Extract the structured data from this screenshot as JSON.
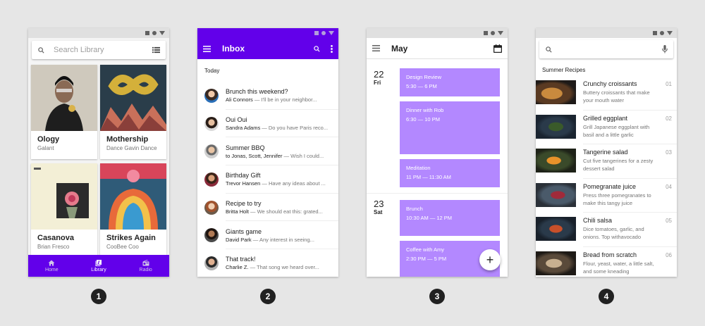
{
  "library": {
    "search_placeholder": "Search Library",
    "cards": [
      {
        "title": "Ology",
        "artist": "Galant"
      },
      {
        "title": "Mothership",
        "artist": "Dance Gavin Dance"
      },
      {
        "title": "Casanova",
        "artist": "Brian Fresco"
      },
      {
        "title": "Strikes Again",
        "artist": "CooBee Coo"
      }
    ],
    "nav": [
      {
        "label": "Home",
        "icon": "home-icon"
      },
      {
        "label": "Library",
        "icon": "library-icon"
      },
      {
        "label": "Radio",
        "icon": "radio-icon"
      }
    ],
    "accent": "#6200ea"
  },
  "inbox": {
    "title": "Inbox",
    "section": "Today",
    "emails": [
      {
        "subject": "Brunch this weekend?",
        "sender": "Ali Connors",
        "preview": " — I'll be in your neighbor..."
      },
      {
        "subject": "Oui Oui",
        "sender": "Sandra Adams",
        "preview": " — Do you have Paris reco..."
      },
      {
        "subject": "Summer BBQ",
        "sender": "to Jonas, Scott, Jennifer",
        "preview": " — Wish I could..."
      },
      {
        "subject": "Birthday Gift",
        "sender": "Trevor Hansen",
        "preview": " — Have any ideas about ..."
      },
      {
        "subject": "Recipe to try",
        "sender": "Britta Holt",
        "preview": " — We should eat this: grated..."
      },
      {
        "subject": "Giants game",
        "sender": "David Park",
        "preview": " — Any interest in seeing..."
      },
      {
        "subject": "That track!",
        "sender": "Charlie Z.",
        "preview": " — That song we heard over..."
      }
    ]
  },
  "calendar": {
    "month": "May",
    "days": [
      {
        "num": "22",
        "dow": "Fri"
      },
      {
        "num": "23",
        "dow": "Sat"
      }
    ],
    "events": [
      {
        "title": "Design Review",
        "time": "5:30 — 6 PM"
      },
      {
        "title": "Dinner with Rob",
        "time": "6:30 — 10 PM"
      },
      {
        "title": "Meditation",
        "time": "11 PM — 11:30 AM"
      },
      {
        "title": "Brunch",
        "time": "10:30 AM — 12 PM"
      },
      {
        "title": "Coffee with Amy",
        "time": "2:30 PM — 5 PM"
      }
    ],
    "fab": "+",
    "event_color": "#b388ff"
  },
  "recipes": {
    "section": "Summer Recipes",
    "items": [
      {
        "title": "Crunchy croissants",
        "desc": "Buttery croissants that make your mouth water",
        "num": "01"
      },
      {
        "title": "Grilled eggplant",
        "desc": "Grill Japanese eggplant with basil and a little garlic",
        "num": "02"
      },
      {
        "title": "Tangerine salad",
        "desc": "Cut five tangerines for a zesty dessert salad",
        "num": "03"
      },
      {
        "title": "Pomegranate juice",
        "desc": "Press three pomegranates to make this tangy juice",
        "num": "04"
      },
      {
        "title": "Chili salsa",
        "desc": "Dice tomatoes, garlic, and onions. Top withavocado",
        "num": "05"
      },
      {
        "title": "Bread from scratch",
        "desc": "Flour, yeast, water, a little salt, and some kneading",
        "num": "06"
      }
    ]
  },
  "badges": [
    "1",
    "2",
    "3",
    "4"
  ]
}
